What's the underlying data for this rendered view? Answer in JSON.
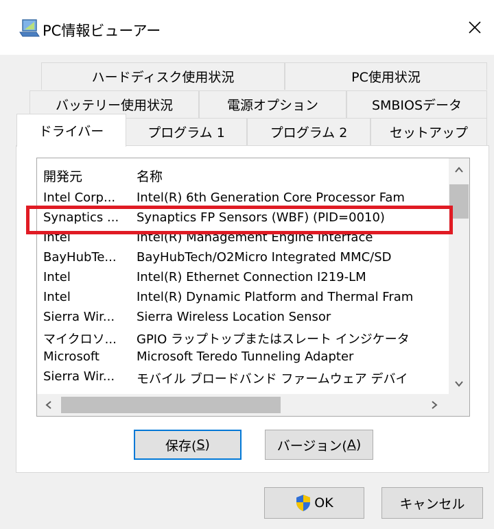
{
  "window": {
    "title": "PC情報ビューアー",
    "close_glyph": "✕"
  },
  "tabs": {
    "row1": [
      "ハードディスク使用状況",
      "PC使用状況"
    ],
    "row2": [
      "バッテリー使用状況",
      "電源オプション",
      "SMBIOSデータ"
    ],
    "row3": [
      "ドライバー",
      "プログラム 1",
      "プログラム 2",
      "セットアップ"
    ],
    "active": "ドライバー"
  },
  "list": {
    "columns": [
      "開発元",
      "名称"
    ],
    "rows": [
      {
        "vendor": "Intel Corp...",
        "name": "Intel(R) 6th Generation Core Processor Fam"
      },
      {
        "vendor": "Synaptics ...",
        "name": "Synaptics FP Sensors (WBF) (PID=0010)"
      },
      {
        "vendor": "Intel",
        "name": "Intel(R) Management Engine Interface"
      },
      {
        "vendor": "BayHubTe...",
        "name": "BayHubTech/O2Micro Integrated MMC/SD"
      },
      {
        "vendor": "Intel",
        "name": "Intel(R) Ethernet Connection I219-LM"
      },
      {
        "vendor": "Intel",
        "name": "Intel(R) Dynamic Platform and Thermal Fram"
      },
      {
        "vendor": "Sierra Wir...",
        "name": "Sierra Wireless Location Sensor"
      },
      {
        "vendor": "マイクロソ...",
        "name": "GPIO ラップトップまたはスレート インジケータ"
      },
      {
        "vendor": "Microsoft",
        "name": "Microsoft Teredo Tunneling Adapter"
      },
      {
        "vendor": "Sierra Wir...",
        "name": "モバイル ブロードバンド ファームウェア デバイ"
      }
    ],
    "highlighted_row": 1,
    "highlight_color": "#e01b24"
  },
  "buttons": {
    "save": {
      "label": "保存(",
      "key": "S",
      "suffix": ")"
    },
    "version": {
      "label": "バージョン(",
      "key": "A",
      "suffix": ")"
    },
    "ok": "OK",
    "cancel": "キャンセル"
  },
  "icons": [
    "app-laptop-icon",
    "close-icon",
    "shield-icon",
    "scroll-up-icon",
    "scroll-down-icon",
    "scroll-left-icon",
    "scroll-right-icon"
  ],
  "colors": {
    "accent": "#0078d7",
    "highlight": "#e01b24"
  }
}
